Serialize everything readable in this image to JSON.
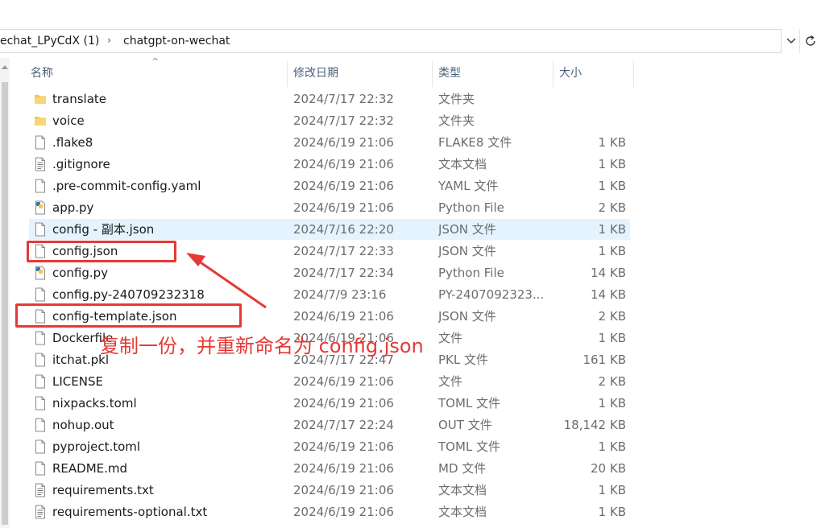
{
  "address": {
    "parent": "echat_LPyCdX (1)",
    "current": "chatgpt-on-wechat"
  },
  "columns": {
    "name": "名称",
    "date": "修改日期",
    "type": "类型",
    "size": "大小"
  },
  "files": [
    {
      "name": "translate",
      "date": "2024/7/17 22:32",
      "type": "文件夹",
      "size": "",
      "icon": "folder-icon"
    },
    {
      "name": "voice",
      "date": "2024/7/17 22:32",
      "type": "文件夹",
      "size": "",
      "icon": "folder-icon"
    },
    {
      "name": ".flake8",
      "date": "2024/6/19 21:06",
      "type": "FLAKE8 文件",
      "size": "1 KB",
      "icon": "file-icon"
    },
    {
      "name": ".gitignore",
      "date": "2024/6/19 21:06",
      "type": "文本文档",
      "size": "1 KB",
      "icon": "text-file-icon"
    },
    {
      "name": ".pre-commit-config.yaml",
      "date": "2024/6/19 21:06",
      "type": "YAML 文件",
      "size": "1 KB",
      "icon": "file-icon"
    },
    {
      "name": "app.py",
      "date": "2024/6/19 21:06",
      "type": "Python File",
      "size": "2 KB",
      "icon": "python-file-icon"
    },
    {
      "name": "config - 副本.json",
      "date": "2024/7/16 22:20",
      "type": "JSON 文件",
      "size": "1 KB",
      "icon": "file-icon",
      "selected": true
    },
    {
      "name": "config.json",
      "date": "2024/7/17 22:33",
      "type": "JSON 文件",
      "size": "1 KB",
      "icon": "file-icon"
    },
    {
      "name": "config.py",
      "date": "2024/7/17 22:34",
      "type": "Python File",
      "size": "14 KB",
      "icon": "python-file-icon"
    },
    {
      "name": "config.py-240709232318",
      "date": "2024/7/9 23:16",
      "type": "PY-2407092323...",
      "size": "14 KB",
      "icon": "file-icon"
    },
    {
      "name": "config-template.json",
      "date": "2024/6/19 21:06",
      "type": "JSON 文件",
      "size": "2 KB",
      "icon": "file-icon"
    },
    {
      "name": "Dockerfile",
      "date": "2024/6/19 21:06",
      "type": "文件",
      "size": "1 KB",
      "icon": "file-icon"
    },
    {
      "name": "itchat.pkl",
      "date": "2024/7/17 22:47",
      "type": "PKL 文件",
      "size": "161 KB",
      "icon": "file-icon"
    },
    {
      "name": "LICENSE",
      "date": "2024/6/19 21:06",
      "type": "文件",
      "size": "2 KB",
      "icon": "file-icon"
    },
    {
      "name": "nixpacks.toml",
      "date": "2024/6/19 21:06",
      "type": "TOML 文件",
      "size": "1 KB",
      "icon": "file-icon"
    },
    {
      "name": "nohup.out",
      "date": "2024/7/17 22:24",
      "type": "OUT 文件",
      "size": "18,142 KB",
      "icon": "file-icon"
    },
    {
      "name": "pyproject.toml",
      "date": "2024/6/19 21:06",
      "type": "TOML 文件",
      "size": "1 KB",
      "icon": "file-icon"
    },
    {
      "name": "README.md",
      "date": "2024/6/19 21:06",
      "type": "MD 文件",
      "size": "20 KB",
      "icon": "file-icon"
    },
    {
      "name": "requirements.txt",
      "date": "2024/6/19 21:06",
      "type": "文本文档",
      "size": "1 KB",
      "icon": "text-file-icon"
    },
    {
      "name": "requirements-optional.txt",
      "date": "2024/6/19 21:06",
      "type": "文本文档",
      "size": "1 KB",
      "icon": "text-file-icon"
    }
  ],
  "annotation": {
    "text": "复制一份，并重新命名为 config.json",
    "color": "#e53935"
  },
  "colors": {
    "selection": "#e5f3ff",
    "header_text": "#4c607a",
    "annotation_red": "#e53935"
  }
}
